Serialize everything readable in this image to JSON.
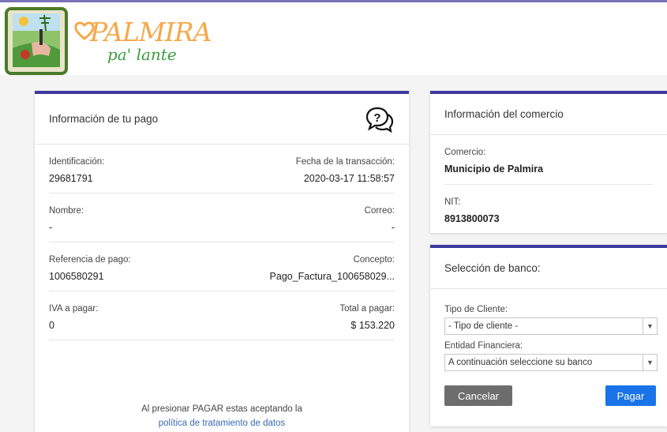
{
  "brand": {
    "name": "PALMIRA",
    "tagline": "pa' lante"
  },
  "payment": {
    "title": "Información de tu pago",
    "rows": [
      {
        "left_label": "Identificación:",
        "left_value": "29681791",
        "right_label": "Fecha de la transacción:",
        "right_value": "2020-03-17 11:58:57"
      },
      {
        "left_label": "Nombre:",
        "left_value": "-",
        "right_label": "Correo:",
        "right_value": "-"
      },
      {
        "left_label": "Referencia de pago:",
        "left_value": "1006580291",
        "right_label": "Concepto:",
        "right_value": "Pago_Factura_100658029..."
      },
      {
        "left_label": "IVA a pagar:",
        "left_value": "0",
        "right_label": "Total a pagar:",
        "right_value": "$ 153.220"
      }
    ],
    "notice_text": "Al presionar PAGAR estas aceptando la",
    "notice_link": "política de tratamiento de datos"
  },
  "merchant": {
    "title": "Información del comercio",
    "comercio_label": "Comercio:",
    "comercio_value": "Municipio de Palmira",
    "nit_label": "NIT:",
    "nit_value": "8913800073"
  },
  "bank": {
    "title": "Selección de banco:",
    "client_type_label": "Tipo de Cliente:",
    "client_type_value": "- Tipo de cliente -",
    "entity_label": "Entidad Financiera:",
    "entity_value": "A continuación seleccione su banco",
    "cancel_label": "Cancelar",
    "pay_label": "Pagar"
  },
  "colors": {
    "accent_border": "#3d3a9e",
    "pay_button": "#1a73e8",
    "cancel_button": "#6d6d6d",
    "link": "#3a6ab3"
  }
}
